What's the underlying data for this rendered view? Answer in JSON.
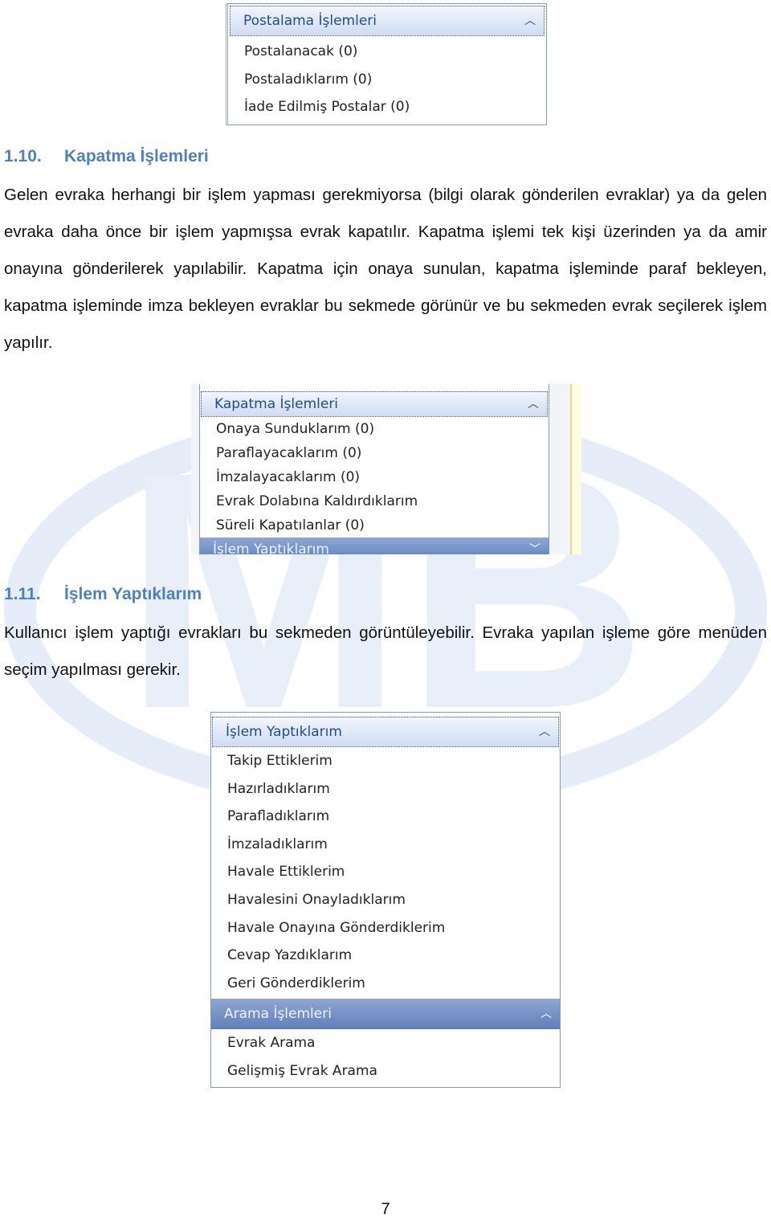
{
  "panels": {
    "postalama": {
      "title": "Postalama İşlemleri",
      "items": [
        "Postalanacak (0)",
        "Postaladıklarım (0)",
        "İade Edilmiş Postalar (0)"
      ]
    },
    "kapatma": {
      "title": "Kapatma İşlemleri",
      "items": [
        "Onaya Sunduklarım (0)",
        "Paraflayacaklarım (0)",
        "İmzalayacaklarım (0)",
        "Evrak Dolabına Kaldırdıklarım",
        "Süreli Kapatılanlar (0)"
      ],
      "next_title": "İşlem Yaptıklarım"
    },
    "islem": {
      "title": "İşlem Yaptıklarım",
      "items": [
        "Takip Ettiklerim",
        "Hazırladıklarım",
        "Parafladıklarım",
        "İmzaladıklarım",
        "Havale Ettiklerim",
        "Havalesini Onayladıklarım",
        "Havale Onayına Gönderdiklerim",
        "Cevap Yazdıklarım",
        "Geri Gönderdiklerim"
      ]
    },
    "arama": {
      "title": "Arama İşlemleri",
      "items": [
        "Evrak Arama",
        "Gelişmiş Evrak Arama"
      ]
    }
  },
  "section_1_10": {
    "number": "1.10.",
    "title": "Kapatma İşlemleri",
    "body": "Gelen evraka herhangi bir işlem yapması gerekmiyorsa (bilgi olarak gönderilen evraklar) ya da gelen evraka daha önce bir işlem yapmışsa evrak kapatılır. Kapatma işlemi tek kişi üzerinden ya da amir onayına gönderilerek yapılabilir. Kapatma için onaya sunulan, kapatma işleminde paraf bekleyen, kapatma işleminde imza bekleyen evraklar bu sekmede görünür ve bu sekmeden evrak seçilerek işlem yapılır."
  },
  "section_1_11": {
    "number": "1.11.",
    "title": "İşlem Yaptıklarım",
    "body": "Kullanıcı işlem yaptığı evrakları bu sekmeden görüntüleyebilir. Evraka yapılan işleme göre menüden seçim yapılması gerekir."
  },
  "page_number": "7",
  "colors": {
    "heading": "#4f81bd",
    "watermark": "#dce6f4"
  }
}
